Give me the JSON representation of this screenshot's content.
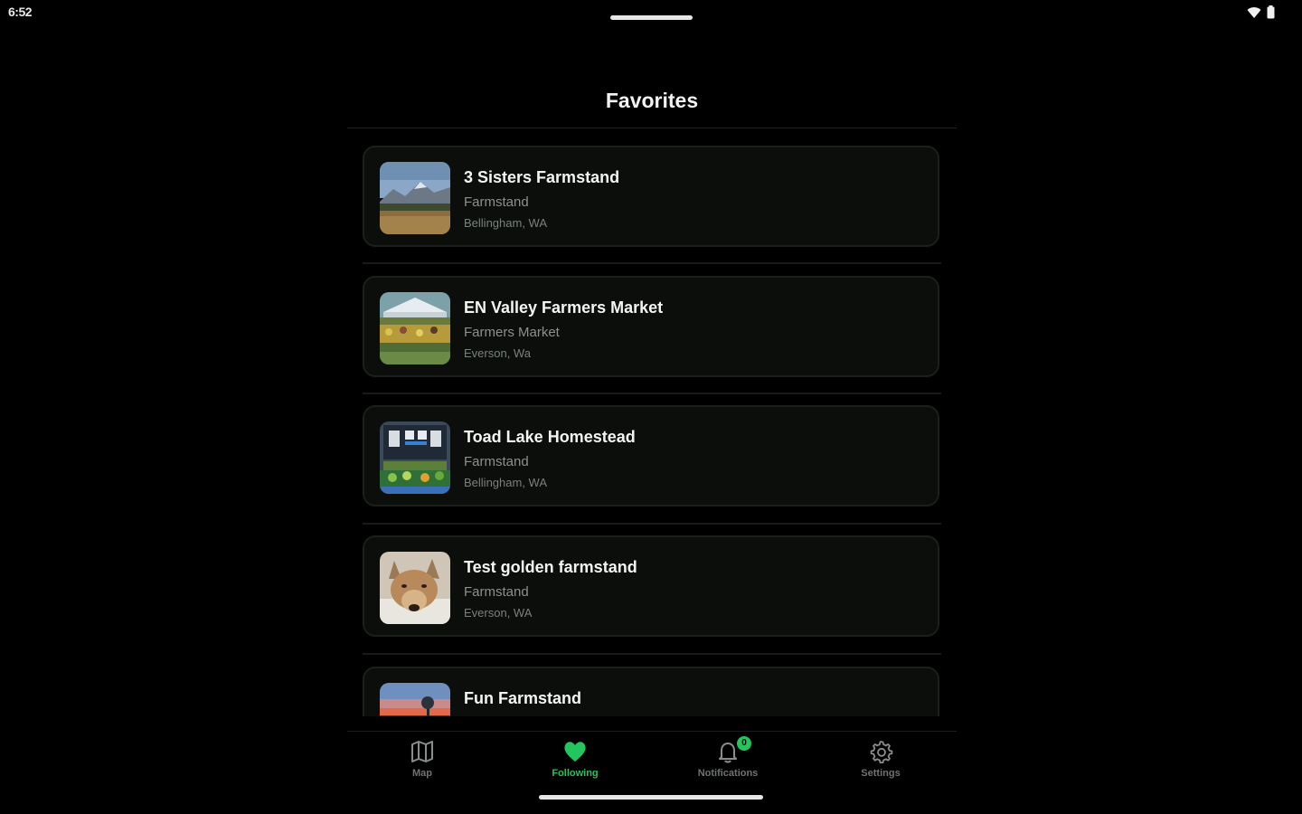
{
  "status_bar": {
    "time": "6:52",
    "icons": [
      "wifi-icon",
      "battery-icon"
    ]
  },
  "page": {
    "title": "Favorites"
  },
  "favorites": [
    {
      "name": "3 Sisters Farmstand",
      "type": "Farmstand",
      "location": "Bellingham, WA",
      "thumbnail": "mountain-field-photo"
    },
    {
      "name": "EN Valley Farmers Market",
      "type": "Farmers Market",
      "location": "Everson, Wa",
      "thumbnail": "market-tent-photo"
    },
    {
      "name": "Toad Lake Homestead",
      "type": "Farmstand",
      "location": "Bellingham, WA",
      "thumbnail": "produce-stand-photo"
    },
    {
      "name": "Test golden farmstand",
      "type": "Farmstand",
      "location": "Everson, WA",
      "thumbnail": "dog-photo"
    },
    {
      "name": "Fun Farmstand",
      "type": "",
      "location": "",
      "thumbnail": "sunset-photo"
    }
  ],
  "bottom_nav": {
    "items": [
      {
        "label": "Map",
        "icon": "map-icon",
        "active": false
      },
      {
        "label": "Following",
        "icon": "heart-icon",
        "active": true
      },
      {
        "label": "Notifications",
        "icon": "bell-icon",
        "active": false,
        "badge": "0"
      },
      {
        "label": "Settings",
        "icon": "gear-icon",
        "active": false
      }
    ]
  },
  "colors": {
    "background": "#000000",
    "card_background": "#0b0e0b",
    "card_border": "#1b201b",
    "accent": "#22c55e",
    "muted_text": "#8d918d"
  }
}
